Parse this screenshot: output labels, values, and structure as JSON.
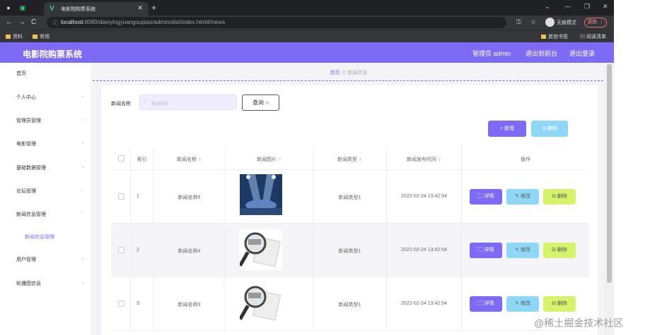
{
  "browser": {
    "tab_title": "电影院购票系统",
    "url_host": "localhost",
    "url_path": ":8080/dianyingyuangoupiao/admin/dist/index.html#/news",
    "incognito_label": "无痕模式",
    "update_label": "更新",
    "bookmarks": [
      "资料",
      "常用"
    ],
    "bookmarks_right": [
      "其他书签",
      "阅读清单"
    ]
  },
  "header": {
    "app_title": "电影院购票系统",
    "user_label": "管理员 admin",
    "to_front": "退出到前台",
    "logout": "退出登录"
  },
  "sidebar": {
    "items": [
      {
        "label": "首页",
        "has_chevron": false
      },
      {
        "label": "个人中心",
        "has_chevron": true
      },
      {
        "label": "管理员管理",
        "has_chevron": true
      },
      {
        "label": "电影管理",
        "has_chevron": true
      },
      {
        "label": "基础数据管理",
        "has_chevron": true
      },
      {
        "label": "论坛管理",
        "has_chevron": true
      },
      {
        "label": "新闻信息管理",
        "has_chevron": true
      },
      {
        "label": "新闻信息管理",
        "sub": true
      },
      {
        "label": "用户管理",
        "has_chevron": true
      },
      {
        "label": "轮播图信息",
        "has_chevron": true
      }
    ]
  },
  "breadcrumb": {
    "home": "首页",
    "current": "新闻信息"
  },
  "search": {
    "label": "新闻名称",
    "placeholder": "新闻名称",
    "button": "查询"
  },
  "actions": {
    "add": "+ 新增",
    "delete": "删除"
  },
  "table": {
    "headers": [
      "索引",
      "新闻名称",
      "新闻图片",
      "新闻类型",
      "新闻发布时间",
      "操作"
    ],
    "rows": [
      {
        "index": "1",
        "name": "新闻名称5",
        "image": "stage-image",
        "type": "新闻类型1",
        "time": "2022-02-24 13:42:54"
      },
      {
        "index": "2",
        "name": "新闻名称4",
        "image": "magnifier-news-image",
        "type": "新闻类型1",
        "time": "2022-02-24 13:42:54"
      },
      {
        "index": "3",
        "name": "新闻名称3",
        "image": "magnifier-news-image",
        "type": "新闻类型1",
        "time": "2022-02-24 13:42:54"
      }
    ],
    "ops": {
      "detail": "详情",
      "edit": "修改",
      "delete": "删除"
    }
  },
  "watermark": "@稀土掘金技术社区",
  "colors": {
    "accent": "#7d6af5",
    "info": "#8fd7f7",
    "warn": "#d7f36b"
  }
}
